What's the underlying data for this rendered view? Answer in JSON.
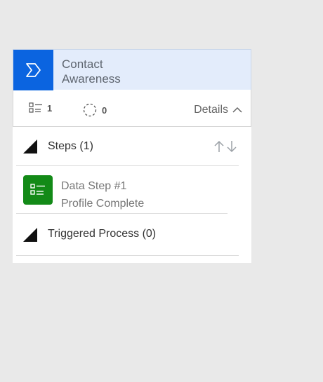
{
  "stage": {
    "title_line1": "Contact",
    "title_line2": "Awareness",
    "icon": "chevron-right-icon",
    "accent": "#0b64e0",
    "header_bg": "#e3ecfb"
  },
  "meta": {
    "steps_count": "1",
    "process_count": "0",
    "details_label": "Details"
  },
  "steps_section": {
    "label": "Steps (1)"
  },
  "step": {
    "title": "Data Step #1",
    "subtitle": "Profile Complete",
    "icon_color": "#138a17"
  },
  "triggered_section": {
    "label": "Triggered Process (0)"
  }
}
